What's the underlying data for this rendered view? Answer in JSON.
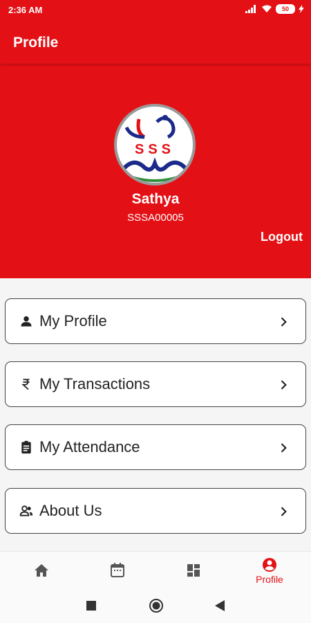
{
  "status_bar": {
    "time": "2:36 AM",
    "battery": "50"
  },
  "app_bar": {
    "title": "Profile"
  },
  "profile": {
    "name": "Sathya",
    "id": "SSSA00005",
    "logout_label": "Logout",
    "logo_text": "SSS"
  },
  "menu": {
    "items": [
      {
        "label": "My Profile",
        "icon": "person-icon"
      },
      {
        "label": "My Transactions",
        "icon": "rupee-icon"
      },
      {
        "label": "My Attendance",
        "icon": "clipboard-icon"
      },
      {
        "label": "About Us",
        "icon": "people-icon"
      }
    ]
  },
  "bottom_nav": {
    "items": [
      {
        "icon": "home-icon",
        "label": ""
      },
      {
        "icon": "calendar-icon",
        "label": ""
      },
      {
        "icon": "dashboard-icon",
        "label": ""
      },
      {
        "icon": "account-circle-icon",
        "label": "Profile",
        "active": true
      }
    ]
  },
  "colors": {
    "primary": "#e31015",
    "background": "#f5f5f5",
    "card_border": "#444444",
    "text": "#222222"
  }
}
